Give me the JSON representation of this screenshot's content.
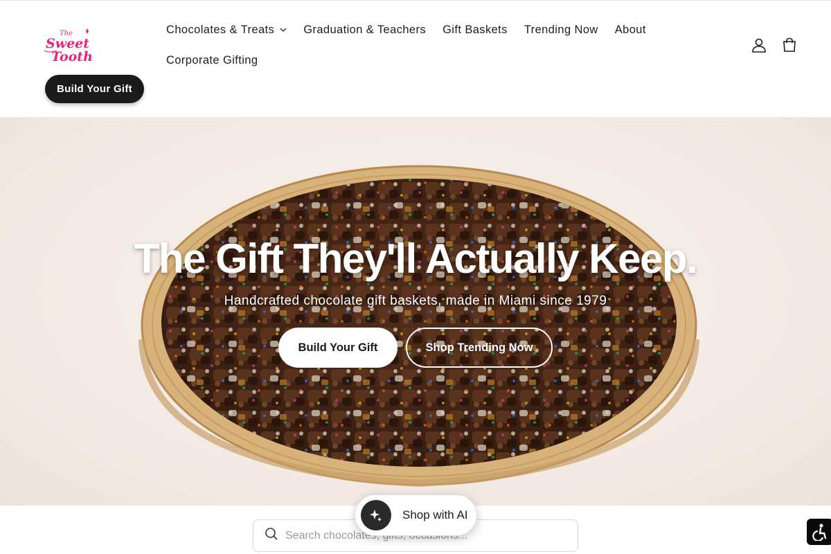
{
  "brand": {
    "logo_line1": "The",
    "logo_line2": "Sweet",
    "logo_line3": "Tooth"
  },
  "header": {
    "build_gift_label": "Build Your Gift",
    "nav": [
      {
        "label": "Chocolates & Treats",
        "has_dropdown": true
      },
      {
        "label": "Graduation & Teachers"
      },
      {
        "label": "Gift Baskets"
      },
      {
        "label": "Trending Now"
      },
      {
        "label": "About"
      },
      {
        "label": "Corporate Gifting"
      }
    ],
    "icons": [
      "account-icon",
      "cart-icon"
    ]
  },
  "hero": {
    "title": "The Gift They'll Actually Keep.",
    "subtitle": "Handcrafted chocolate gift baskets, made in Miami since 1979",
    "primary_button": "Build Your Gift",
    "secondary_button": "Shop Trending Now"
  },
  "shop_ai": {
    "label": "Shop with AI",
    "icon": "sparkle-icon"
  },
  "search": {
    "placeholder": "Search chocolates, gifts, occasions..."
  },
  "accessibility": {
    "icon": "accessibility-icon"
  },
  "colors": {
    "brand_pink": "#e6247d",
    "button_dark": "#1a1a1a",
    "hero_bg": "#f4ebe6"
  }
}
